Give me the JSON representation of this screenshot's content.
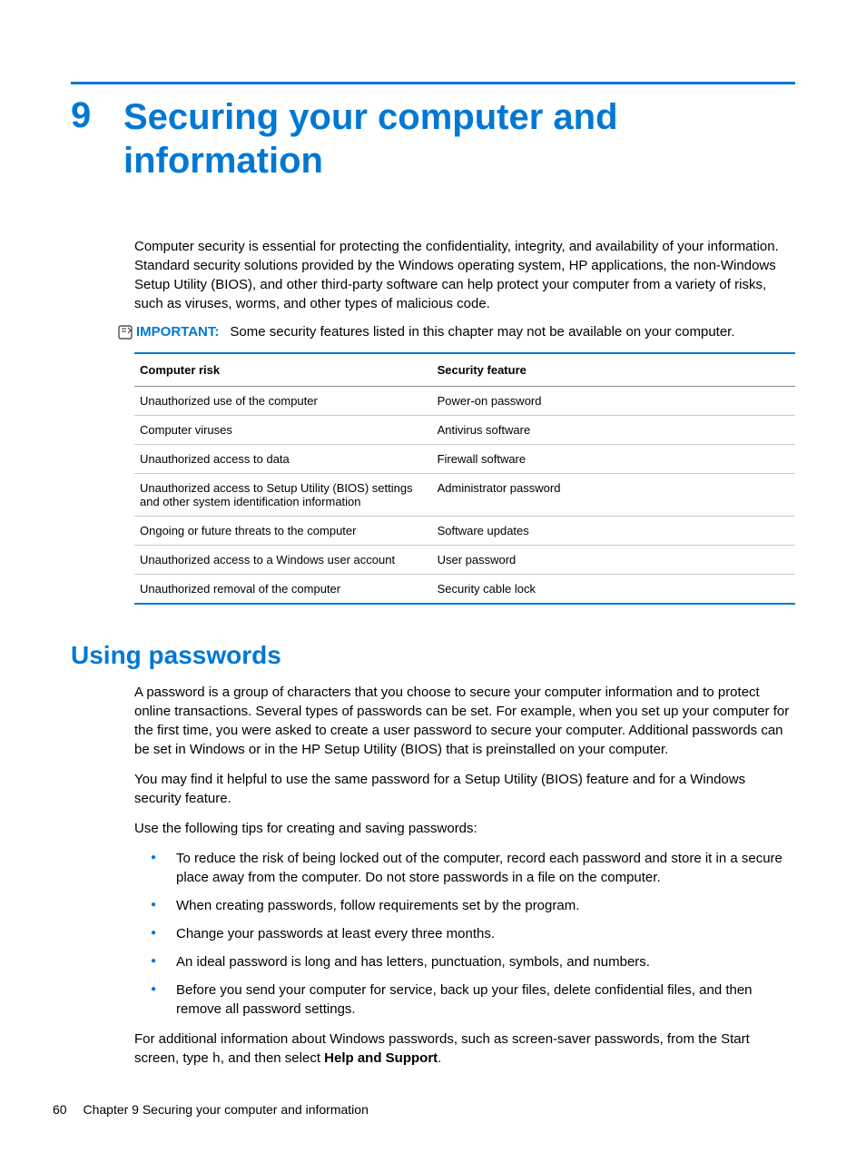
{
  "chapter": {
    "number": "9",
    "title": "Securing your computer and information"
  },
  "intro": "Computer security is essential for protecting the confidentiality, integrity, and availability of your information. Standard security solutions provided by the Windows operating system, HP applications, the non-Windows Setup Utility (BIOS), and other third-party software can help protect your computer from a variety of risks, such as viruses, worms, and other types of malicious code.",
  "important": {
    "label": "IMPORTANT:",
    "text": "Some security features listed in this chapter may not be available on your computer."
  },
  "table": {
    "headers": {
      "col1": "Computer risk",
      "col2": "Security feature"
    },
    "rows": [
      {
        "risk": "Unauthorized use of the computer",
        "feature": "Power-on password"
      },
      {
        "risk": "Computer viruses",
        "feature": "Antivirus software"
      },
      {
        "risk": "Unauthorized access to data",
        "feature": "Firewall software"
      },
      {
        "risk": "Unauthorized access to Setup Utility (BIOS) settings and other system identification information",
        "feature": "Administrator password"
      },
      {
        "risk": "Ongoing or future threats to the computer",
        "feature": "Software updates"
      },
      {
        "risk": "Unauthorized access to a Windows user account",
        "feature": "User password"
      },
      {
        "risk": "Unauthorized removal of the computer",
        "feature": "Security cable lock"
      }
    ]
  },
  "section": {
    "heading": "Using passwords",
    "p1": "A password is a group of characters that you choose to secure your computer information and to protect online transactions. Several types of passwords can be set. For example, when you set up your computer for the first time, you were asked to create a user password to secure your computer. Additional passwords can be set in Windows or in the HP Setup Utility (BIOS) that is preinstalled on your computer.",
    "p2": "You may find it helpful to use the same password for a Setup Utility (BIOS) feature and for a Windows security feature.",
    "p3": "Use the following tips for creating and saving passwords:",
    "bullets": [
      "To reduce the risk of being locked out of the computer, record each password and store it in a secure place away from the computer. Do not store passwords in a file on the computer.",
      "When creating passwords, follow requirements set by the program.",
      "Change your passwords at least every three months.",
      "An ideal password is long and has letters, punctuation, symbols, and numbers.",
      "Before you send your computer for service, back up your files, delete confidential files, and then remove all password settings."
    ],
    "p4_pre": "For additional information about Windows passwords, such as screen-saver passwords, from the Start screen, type ",
    "p4_code": "h",
    "p4_mid": ", and then select ",
    "p4_bold": "Help and Support",
    "p4_post": "."
  },
  "footer": {
    "page": "60",
    "text": "Chapter 9   Securing your computer and information"
  }
}
